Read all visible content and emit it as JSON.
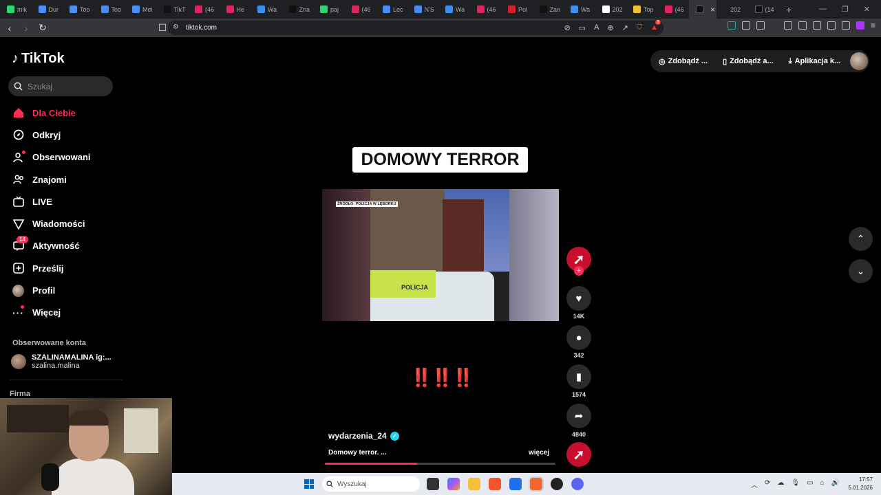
{
  "browser": {
    "tabs": [
      {
        "label": "mik",
        "color": "#2bd673"
      },
      {
        "label": "Dur",
        "color": "#4a8df6"
      },
      {
        "label": "Too",
        "color": "#4a8df6"
      },
      {
        "label": "Too",
        "color": "#4a8df6"
      },
      {
        "label": "Mei",
        "color": "#4a8df6"
      },
      {
        "label": "TikT",
        "color": "#111111"
      },
      {
        "label": "(46",
        "color": "#e0245e"
      },
      {
        "label": "He",
        "color": "#e0245e"
      },
      {
        "label": "Wa",
        "color": "#3a8ff0"
      },
      {
        "label": "Zna",
        "color": "#111111"
      },
      {
        "label": "paj",
        "color": "#2bd673"
      },
      {
        "label": "(46",
        "color": "#e0245e"
      },
      {
        "label": "Lec",
        "color": "#4a8df6"
      },
      {
        "label": "N'S",
        "color": "#4a8df6"
      },
      {
        "label": "Wa",
        "color": "#3a8ff0"
      },
      {
        "label": "(46",
        "color": "#e0245e"
      },
      {
        "label": "Pol",
        "color": "#d4202a"
      },
      {
        "label": "Zan",
        "color": "#111111"
      },
      {
        "label": "Wa",
        "color": "#3a8ff0"
      },
      {
        "label": "202",
        "color": "#ffffff"
      },
      {
        "label": "Top",
        "color": "#f1c232"
      },
      {
        "label": "(46",
        "color": "#e0245e"
      }
    ],
    "active_tab_close": "×",
    "after_tabs": [
      {
        "label": "202"
      },
      {
        "label": "(14"
      }
    ],
    "new_tab": "+",
    "url": "tiktok.com",
    "ext_badge": "3"
  },
  "tiktok": {
    "logo_text": "TikTok",
    "search_placeholder": "Szukaj",
    "menu": [
      {
        "label": "Dla Ciebie",
        "icon": "home-icon"
      },
      {
        "label": "Odkryj",
        "icon": "compass-icon"
      },
      {
        "label": "Obserwowani",
        "icon": "following-icon"
      },
      {
        "label": "Znajomi",
        "icon": "friends-icon"
      },
      {
        "label": "LIVE",
        "icon": "live-icon"
      },
      {
        "label": "Wiadomości",
        "icon": "messages-icon"
      },
      {
        "label": "Aktywność",
        "icon": "activity-icon",
        "badge": "14"
      },
      {
        "label": "Prześlij",
        "icon": "upload-icon"
      },
      {
        "label": "Profil",
        "icon": "profile-icon"
      },
      {
        "label": "Więcej",
        "icon": "more-icon"
      }
    ],
    "followed_title": "Obserwowane konta",
    "followed": {
      "name": "SZALINAMALINA ig:...",
      "handle": "szalina.malina"
    },
    "firma": "Firma",
    "top_buttons": [
      "Zdobądź ...",
      "Zdobądź a...",
      "Aplikacja k..."
    ],
    "video": {
      "caption_title": "DOMOWY TERROR",
      "source_label": "ŹRÓDŁO: POLICJA W LĘBORKU",
      "police_text": "POLICJA",
      "exclaim": "‼️‼️‼️",
      "author": "wydarzenia_24",
      "description": "Domowy terror. ...",
      "more": "więcej",
      "progress": 0.4
    },
    "actions": {
      "likes": "14K",
      "comments": "342",
      "saves": "1574",
      "shares": "4840"
    }
  },
  "taskbar": {
    "search_placeholder": "Wyszukaj",
    "time": "17:57",
    "date": "5.01.2026"
  }
}
